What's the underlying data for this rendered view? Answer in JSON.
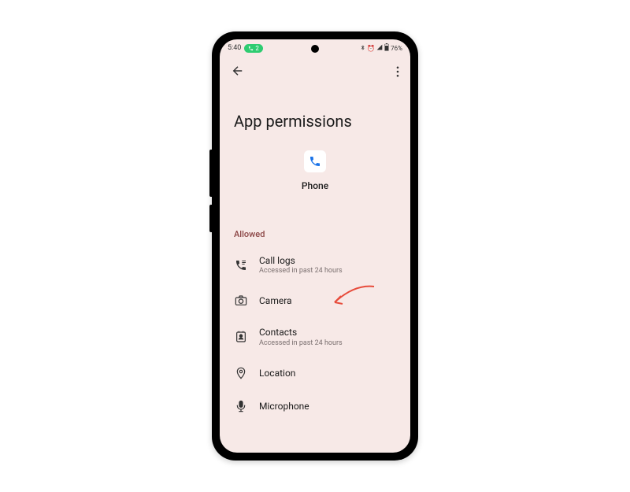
{
  "status": {
    "time": "5:40",
    "badge": "2",
    "battery": "76%"
  },
  "page": {
    "title": "App permissions"
  },
  "app": {
    "name": "Phone"
  },
  "section": {
    "allowed_header": "Allowed"
  },
  "permissions": [
    {
      "title": "Call logs",
      "sub": "Accessed in past 24 hours"
    },
    {
      "title": "Camera",
      "sub": ""
    },
    {
      "title": "Contacts",
      "sub": "Accessed in past 24 hours"
    },
    {
      "title": "Location",
      "sub": ""
    },
    {
      "title": "Microphone",
      "sub": ""
    }
  ]
}
